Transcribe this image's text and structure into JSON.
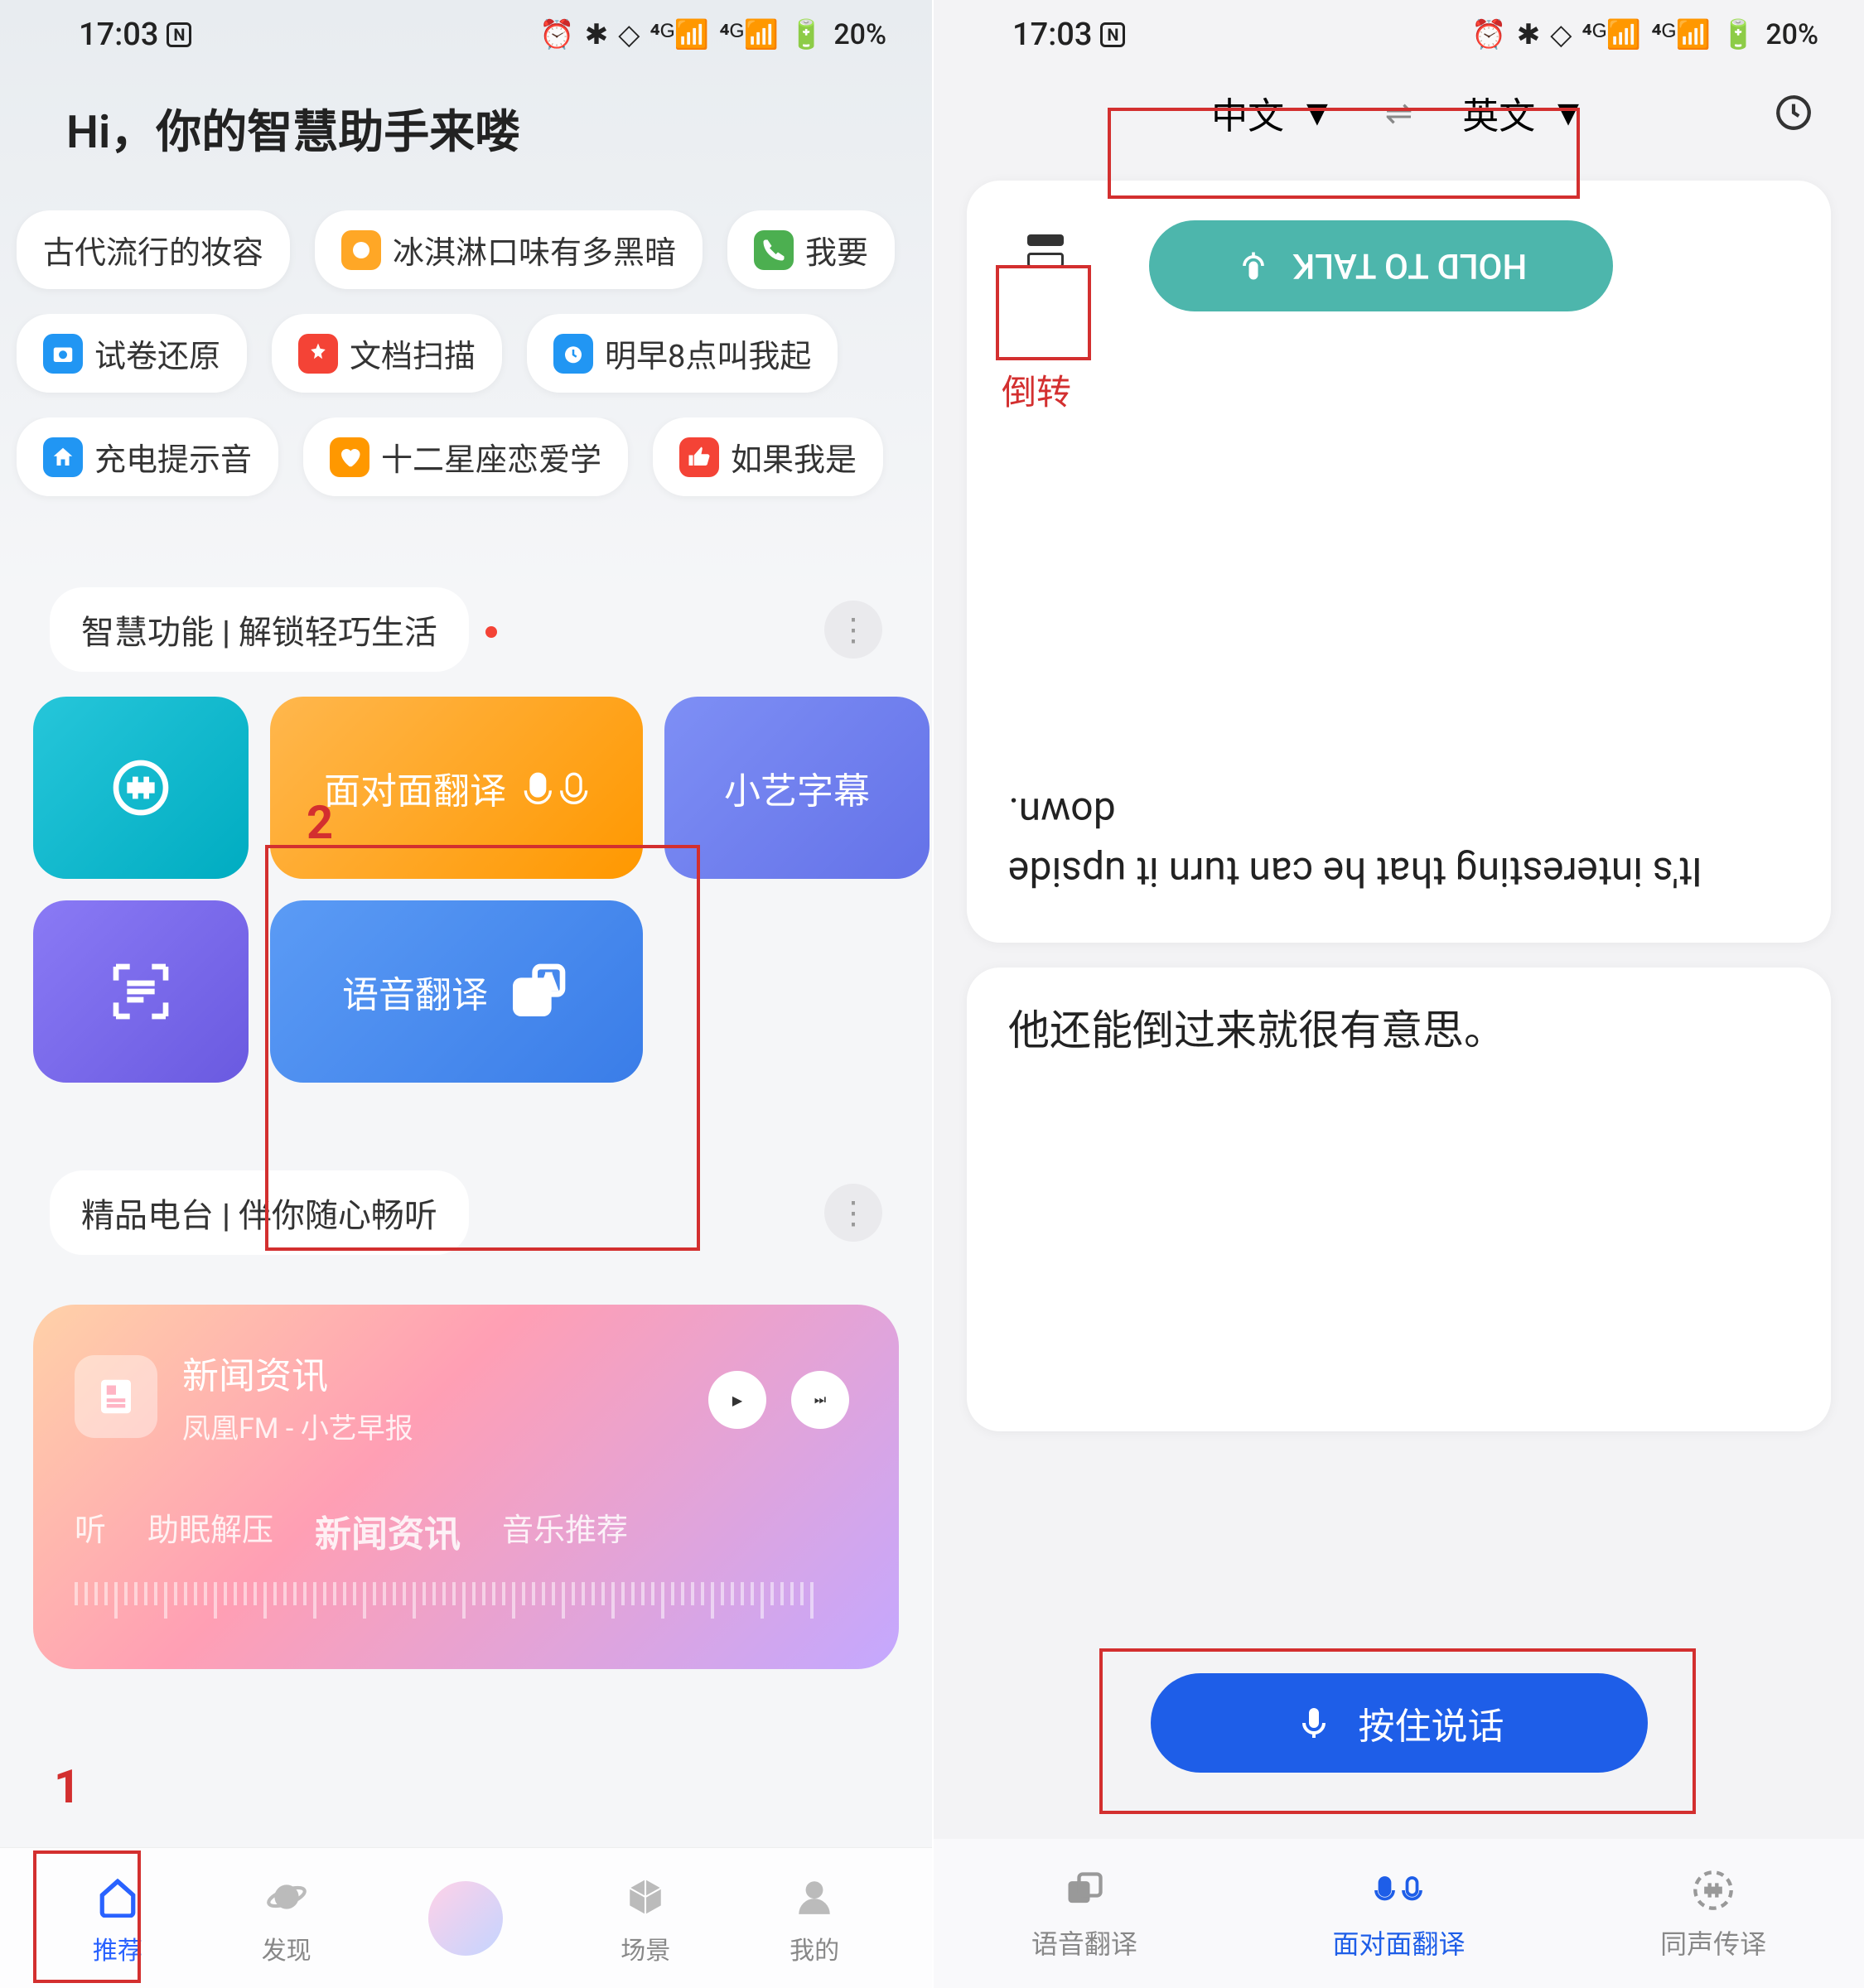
{
  "statusbar": {
    "time": "17:03",
    "battery": "20%"
  },
  "left": {
    "greeting": "Hi，你的智慧助手来喽",
    "chipsRow1": [
      "古代流行的妆容",
      "冰淇淋口味有多黑暗",
      "我要"
    ],
    "chipsRow2": [
      "试卷还原",
      "文档扫描",
      "明早8点叫我起"
    ],
    "chipsRow3": [
      "充电提示音",
      "十二星座恋爱学",
      "如果我是"
    ],
    "section1Title": "智慧功能 | 解锁轻巧生活",
    "cardLabels": {
      "face": "面对面翻译",
      "subtitle": "小艺字幕",
      "voice": "语音翻译"
    },
    "section2Title": "精品电台 | 伴你随心畅听",
    "radio": {
      "title": "新闻资讯",
      "sub": "凤凰FM - 小艺早报",
      "tabs": [
        "听",
        "助眠解压",
        "新闻资讯",
        "音乐推荐"
      ]
    },
    "nav": [
      "推荐",
      "发现",
      "",
      "场景",
      "我的"
    ]
  },
  "right": {
    "langFrom": "中文",
    "langTo": "英文",
    "holdLabel": "HOLD TO TALK",
    "translated": "It's interesting that he can turn it upside down.",
    "source": "他还能倒过来就很有意思。",
    "pressLabel": "按住说话",
    "nav": [
      "语音翻译",
      "面对面翻译",
      "同声传译"
    ],
    "flipLabel": "倒转"
  },
  "callouts": {
    "one": "1",
    "two": "2"
  }
}
